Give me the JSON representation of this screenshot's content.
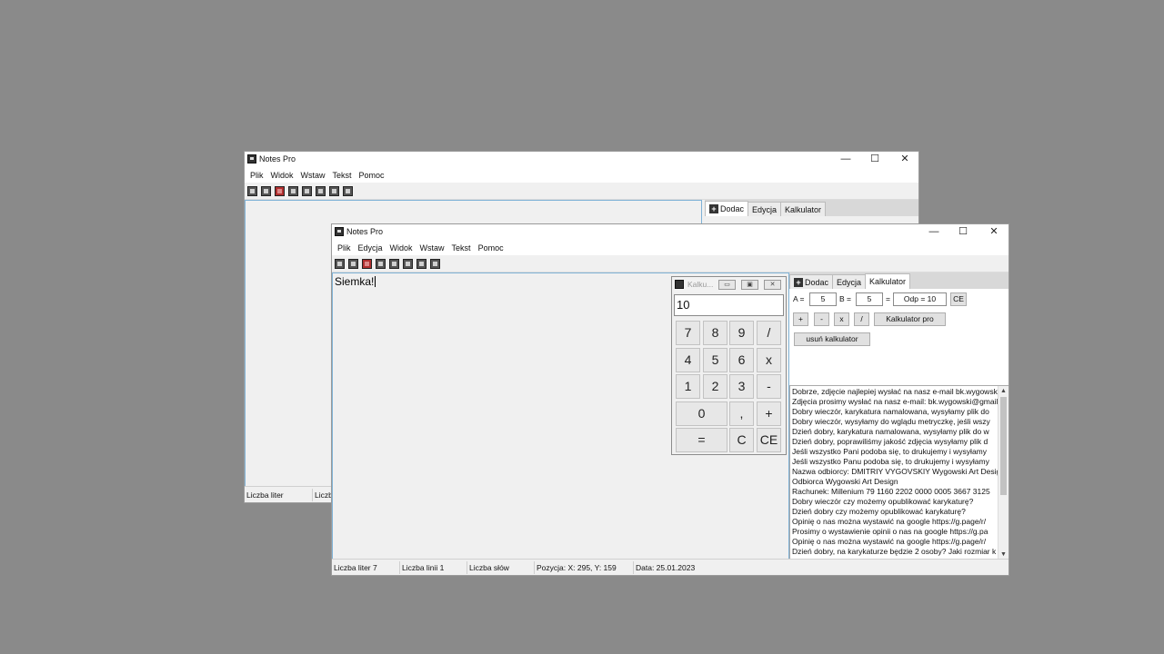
{
  "back_window": {
    "title": "Notes Pro",
    "controls": {
      "minimize": "—",
      "maximize": "☐",
      "close": "✕"
    },
    "menu": [
      "Plik",
      "Widok",
      "Wstaw",
      "Tekst",
      "Pomoc"
    ],
    "tabs": {
      "add": "Dodac",
      "edit": "Edycja",
      "calc": "Kalkulator"
    },
    "status": {
      "letters": "Liczba liter",
      "lines": "Liczba"
    }
  },
  "front_window": {
    "title": "Notes Pro",
    "controls": {
      "minimize": "—",
      "maximize": "☐",
      "close": "✕"
    },
    "menu": [
      "Plik",
      "Edycja",
      "Widok",
      "Wstaw",
      "Tekst",
      "Pomoc"
    ],
    "editor_text": "Siemka!",
    "tabs": {
      "add": "Dodac",
      "edit": "Edycja",
      "calc": "Kalkulator"
    },
    "calc_panel": {
      "a_label": "A =",
      "a_value": "5",
      "b_label": "B =",
      "b_value": "5",
      "eq_label": "=",
      "result": "Odp = 10",
      "ce": "CE",
      "plus": "+",
      "minus": "-",
      "times": "x",
      "divide": "/",
      "pro_button": "Kalkulator pro",
      "remove_button": "usuń kalkulator"
    },
    "messages": [
      "Dobrze, zdjęcie najlepiej wysłać na nasz e-mail bk.wygowski",
      "Zdjęcia prosimy wysłać na nasz e-mail: bk.wygowski@gmail",
      "Dobry wieczór, karykatura namalowana, wysyłamy plik do",
      "Dobry wieczór, wysyłamy do wglądu metryczkę, jeśli wszy",
      "Dzień dobry, karykatura namalowana, wysyłamy plik do w",
      "Dzień dobry, poprawiliśmy jakość zdjęcia wysyłamy plik d",
      "Jeśli wszystko Pani podoba się, to drukujemy i wysyłamy",
      "Jeśli wszystko Panu podoba się, to drukujemy i wysyłamy",
      "Nazwa odbiorcy: DMITRIY VYGOVSKIY Wygowski Art Desig",
      "Odbiorca Wygowski Art Design",
      "Rachunek: Millenium 79 1160 2202 0000 0005 3667 3125",
      "Dobry wieczór czy możemy opublikować karykaturę?",
      "Dzień dobry  czy możemy opublikować karykaturę?",
      "Opinię o nas można wystawić na google https://g.page/r/",
      "Prosimy o wystawienie opinii o nas na google https://g.pa",
      "Opinię o nas można wystawić na google https://g.page/r/",
      "Dzień dobry, na karykaturze będzie 2 osoby? Jaki rozmiar k"
    ],
    "status": {
      "letters": "Liczba liter 7",
      "lines": "Liczba linii 1",
      "words": "Liczba słów",
      "position": "Pozycja: X: 295, Y: 159",
      "date": "Data: 25.01.2023"
    }
  },
  "calculator": {
    "title": "Kalku...",
    "controls": {
      "minimize": "▭",
      "maximize": "▣",
      "close": "✕"
    },
    "display": "10",
    "keys": [
      "7",
      "8",
      "9",
      "/",
      "4",
      "5",
      "6",
      "x",
      "1",
      "2",
      "3",
      "-",
      "0",
      ",",
      "+",
      "=",
      "C",
      "CE"
    ]
  }
}
